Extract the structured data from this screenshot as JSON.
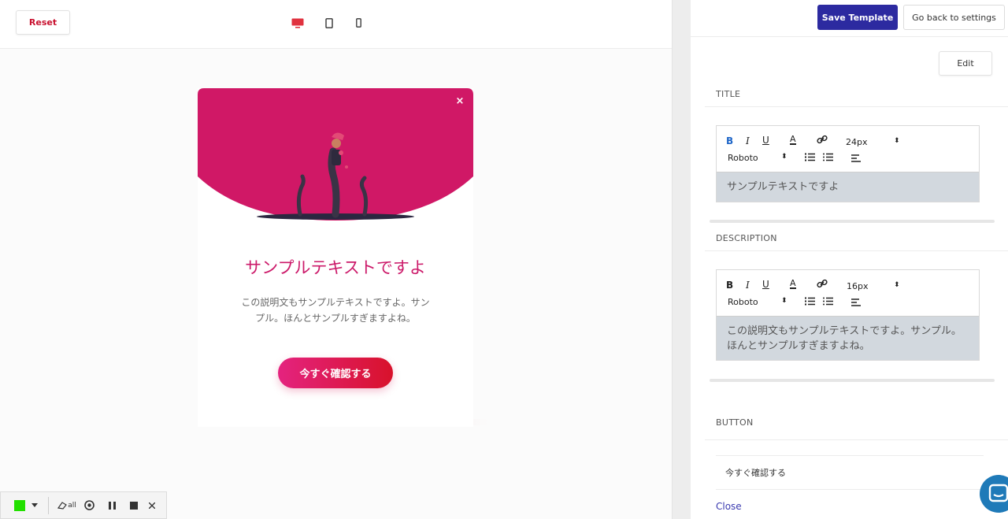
{
  "preview": {
    "reset_label": "Reset",
    "device_icons": [
      "desktop-icon",
      "tablet-icon",
      "mobile-icon"
    ],
    "active_device": "desktop",
    "popup": {
      "close_glyph": "×",
      "title": "サンプルテキストですよ",
      "description": "この説明文もサンプルテキストですよ。サンプル。ほんとサンプルすぎますよね。",
      "cta_label": "今すぐ確認する"
    }
  },
  "recorder": {
    "items": [
      "color-swatch-icon",
      "chevron-down-icon",
      "eraser-icon",
      "target-icon",
      "pause-icon",
      "stop-icon",
      "close-icon"
    ],
    "eraser_label": "all"
  },
  "panel": {
    "save_label": "Save Template",
    "back_label": "Go back to settings",
    "edit_label": "Edit",
    "title_section": {
      "label": "TITLE",
      "font_size": "24px",
      "font_family": "Roboto",
      "content": "サンプルテキストですよ"
    },
    "description_section": {
      "label": "DESCRIPTION",
      "font_size": "16px",
      "font_family": "Roboto",
      "content": "この説明文もサンプルテキストですよ。サンプル。ほんとサンプルすぎますよね。"
    },
    "button_section": {
      "label": "BUTTON",
      "value": "今すぐ確認する"
    },
    "close_label": "Close"
  },
  "colors": {
    "accent_red": "#c8102e",
    "popup_magenta": "#cc1a6a",
    "save_blue": "#2c2aa0",
    "editor_body": "#d2d8de"
  }
}
